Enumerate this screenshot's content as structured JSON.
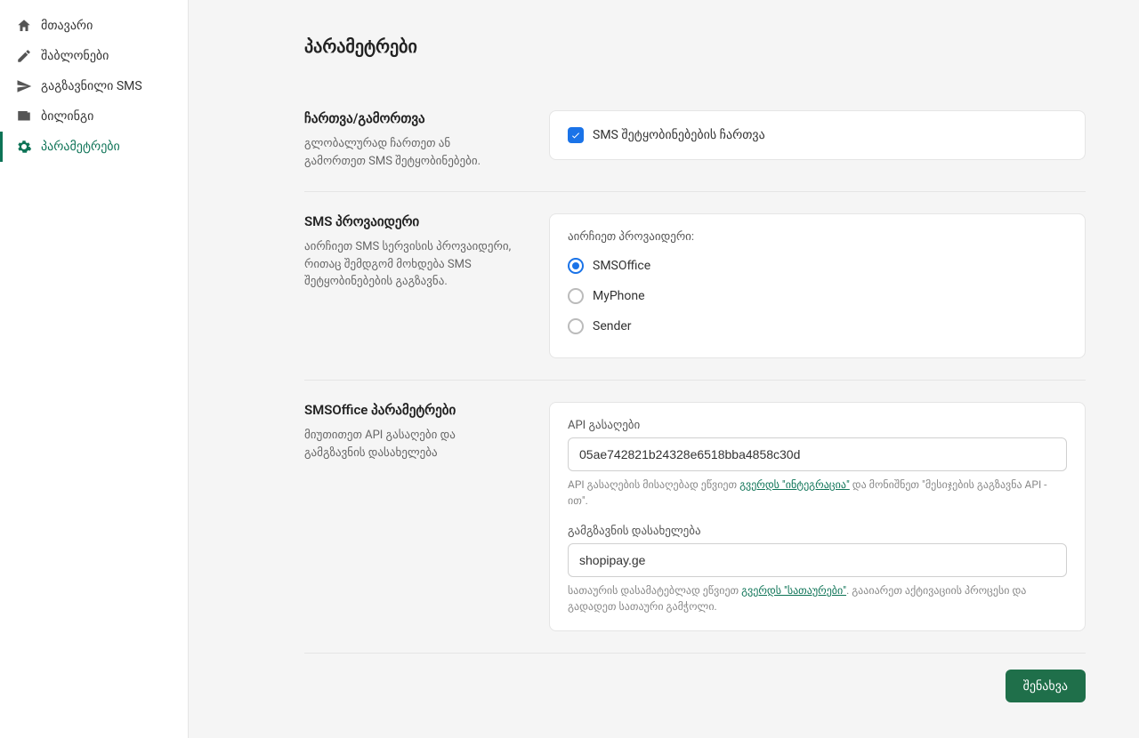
{
  "sidebar": {
    "items": [
      {
        "label": "მთავარი"
      },
      {
        "label": "შაბლონები"
      },
      {
        "label": "გაგზავნილი SMS"
      },
      {
        "label": "ბილინგი"
      },
      {
        "label": "პარამეტრები"
      }
    ]
  },
  "page": {
    "title": "პარამეტრები"
  },
  "sections": {
    "toggle": {
      "title": "ჩართვა/გამორთვა",
      "desc": "გლობალურად ჩართეთ ან გამორთეთ SMS შეტყობინებები.",
      "checkbox_label": "SMS შეტყობინებების ჩართვა"
    },
    "provider": {
      "title": "SMS პროვაიდერი",
      "desc": "აირჩიეთ SMS სერვისის პროვაიდერი, რითაც შემდგომ მოხდება SMS შეტყობინებების გაგზავნა.",
      "choose_label": "აირჩიეთ პროვაიდერი:",
      "options": [
        {
          "label": "SMSOffice"
        },
        {
          "label": "MyPhone"
        },
        {
          "label": "Sender"
        }
      ]
    },
    "smsoffice": {
      "title": "SMSOffice პარამეტრები",
      "desc": "მიუთითეთ API გასაღები და გამგზავნის დასახელება",
      "api_label": "API გასაღები",
      "api_value": "05ae742821b24328e6518bba4858c30d",
      "api_help_before": "API გასაღების მისაღებად ეწვიეთ ",
      "api_help_link": "გვერდს \"ინტეგრაცია\"",
      "api_help_after": " და მონიშნეთ \"მესიჯების გაგზავნა API - ით\".",
      "sender_label": "გამგზავნის დასახელება",
      "sender_value": "shopipay.ge",
      "sender_help_before": "სათაურის დასამატებლად ეწვიეთ ",
      "sender_help_link": "გვერდს \"სათაურები\"",
      "sender_help_after": ". გააიარეთ აქტივაციის პროცესი და გადადეთ სათაური გამჭოლი."
    }
  },
  "actions": {
    "save": "შენახვა"
  }
}
